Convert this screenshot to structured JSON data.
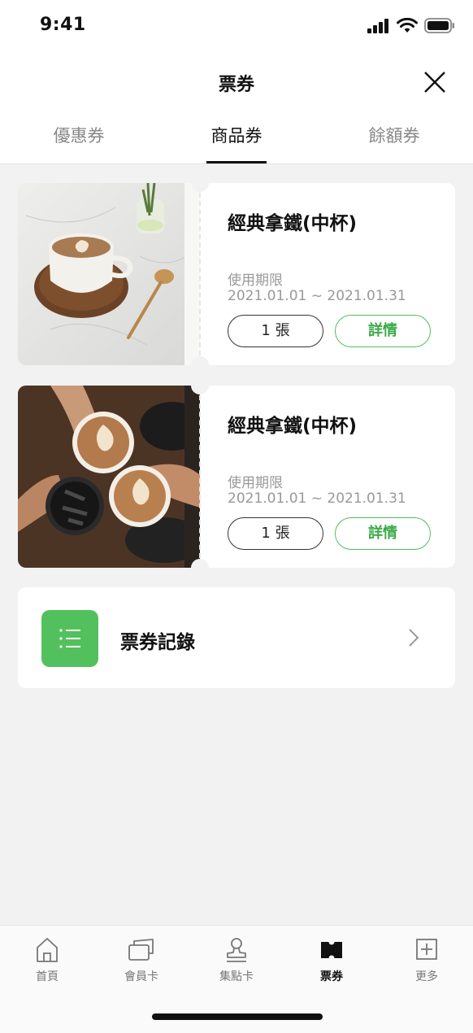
{
  "status_bar": {
    "time": "9:41"
  },
  "header": {
    "title": "票券"
  },
  "tabs": [
    {
      "label": "優惠券",
      "active": false
    },
    {
      "label": "商品券",
      "active": true
    },
    {
      "label": "餘額券",
      "active": false
    }
  ],
  "tickets": [
    {
      "title": "經典拿鐵(中杯)",
      "validity_label": "使用期限",
      "validity_range": "2021.01.01 ~ 2021.01.31",
      "count_label": "1 張",
      "detail_label": "詳情"
    },
    {
      "title": "經典拿鐵(中杯)",
      "validity_label": "使用期限",
      "validity_range": "2021.01.01 ~ 2021.01.31",
      "count_label": "1 張",
      "detail_label": "詳情"
    }
  ],
  "record": {
    "label": "票券記錄",
    "icon": "list-icon"
  },
  "tabbar": [
    {
      "label": "首頁",
      "icon": "home-icon",
      "active": false
    },
    {
      "label": "會員卡",
      "icon": "member-card-icon",
      "active": false
    },
    {
      "label": "集點卡",
      "icon": "stamp-icon",
      "active": false
    },
    {
      "label": "票券",
      "icon": "ticket-icon",
      "active": true
    },
    {
      "label": "更多",
      "icon": "plus-box-icon",
      "active": false
    }
  ],
  "colors": {
    "accent": "#53c05e",
    "background": "#f2f2f2"
  }
}
